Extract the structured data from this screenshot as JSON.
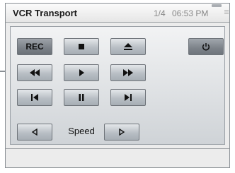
{
  "window": {
    "title": "VCR Transport",
    "page_indicator": "1/4",
    "time": "06:53 PM",
    "icons": [
      "battery-icon",
      "menu-icon"
    ]
  },
  "controls": {
    "rec_label": "REC",
    "speed_label": "Speed",
    "icons": [
      "stop-icon",
      "eject-icon",
      "power-icon",
      "rewind-icon",
      "play-icon",
      "fast-forward-icon",
      "skip-previous-icon",
      "pause-icon",
      "skip-next-icon",
      "speed-down-icon",
      "speed-up-icon"
    ]
  },
  "colors": {
    "icon": "#111111",
    "button_light": "#c3c8cd",
    "button_dark": "#7a8087"
  }
}
